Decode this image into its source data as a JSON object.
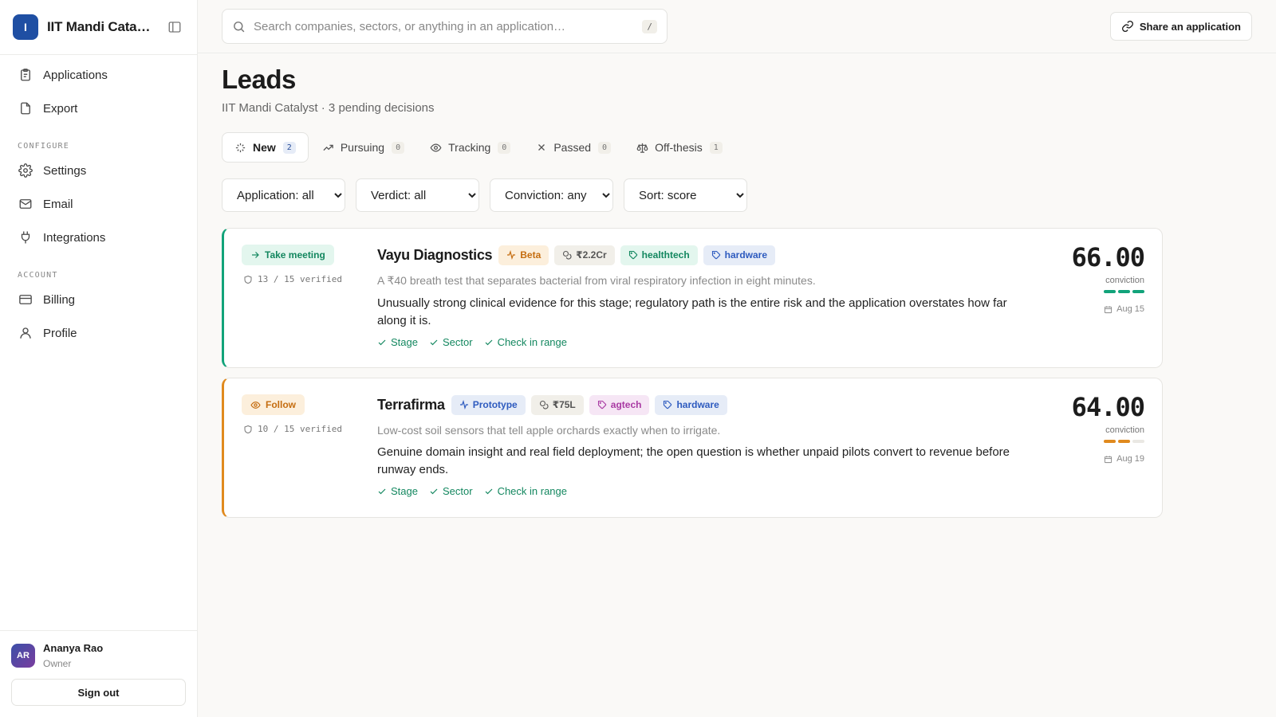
{
  "org": {
    "initial": "I",
    "name": "IIT Mandi Catalyst"
  },
  "sidebar": {
    "items_top": [
      {
        "label": "Applications",
        "icon": "clipboard-icon"
      },
      {
        "label": "Export",
        "icon": "file-icon"
      }
    ],
    "section_configure": "CONFIGURE",
    "items_configure": [
      {
        "label": "Settings",
        "icon": "gear-icon"
      },
      {
        "label": "Email",
        "icon": "mail-icon"
      },
      {
        "label": "Integrations",
        "icon": "plug-icon"
      }
    ],
    "section_account": "ACCOUNT",
    "items_account": [
      {
        "label": "Billing",
        "icon": "credit-card-icon"
      },
      {
        "label": "Profile",
        "icon": "user-icon"
      }
    ]
  },
  "user": {
    "initials": "AR",
    "name": "Ananya Rao",
    "role": "Owner",
    "signout": "Sign out"
  },
  "search": {
    "placeholder": "Search companies, sectors, or anything in an application…",
    "shortcut": "/"
  },
  "share_label": "Share an application",
  "page": {
    "title": "Leads",
    "subtitle": "IIT Mandi Catalyst · 3 pending decisions"
  },
  "tabs": [
    {
      "label": "New",
      "count": "2",
      "active": true
    },
    {
      "label": "Pursuing",
      "count": "0"
    },
    {
      "label": "Tracking",
      "count": "0"
    },
    {
      "label": "Passed",
      "count": "0"
    },
    {
      "label": "Off-thesis",
      "count": "1"
    }
  ],
  "filters": {
    "application": "Application: all",
    "verdict": "Verdict: all",
    "conviction": "Conviction: any",
    "sort": "Sort: score"
  },
  "leads": [
    {
      "verdict": "Take meeting",
      "verified": "13 / 15 verified",
      "name": "Vayu Diagnostics",
      "stage": "Beta",
      "amount": "₹2.2Cr",
      "tags": [
        "healthtech",
        "hardware"
      ],
      "tagline": "A ₹40 breath test that separates bacterial from viral respiratory infection in eight minutes.",
      "summary": "Unusually strong clinical evidence for this stage; regulatory path is the entire risk and the application overstates how far along it is.",
      "checks": [
        "Stage",
        "Sector",
        "Check in range"
      ],
      "score": "66.00",
      "score_label": "conviction",
      "conviction_level": 3,
      "date": "Aug 15",
      "color": "#12a37a"
    },
    {
      "verdict": "Follow",
      "verified": "10 / 15 verified",
      "name": "Terrafirma",
      "stage": "Prototype",
      "amount": "₹75L",
      "tags": [
        "agtech",
        "hardware"
      ],
      "tagline": "Low-cost soil sensors that tell apple orchards exactly when to irrigate.",
      "summary": "Genuine domain insight and real field deployment; the open question is whether unpaid pilots convert to revenue before runway ends.",
      "checks": [
        "Stage",
        "Sector",
        "Check in range"
      ],
      "score": "64.00",
      "score_label": "conviction",
      "conviction_level": 2,
      "date": "Aug 19",
      "color": "#e08a1e"
    }
  ]
}
